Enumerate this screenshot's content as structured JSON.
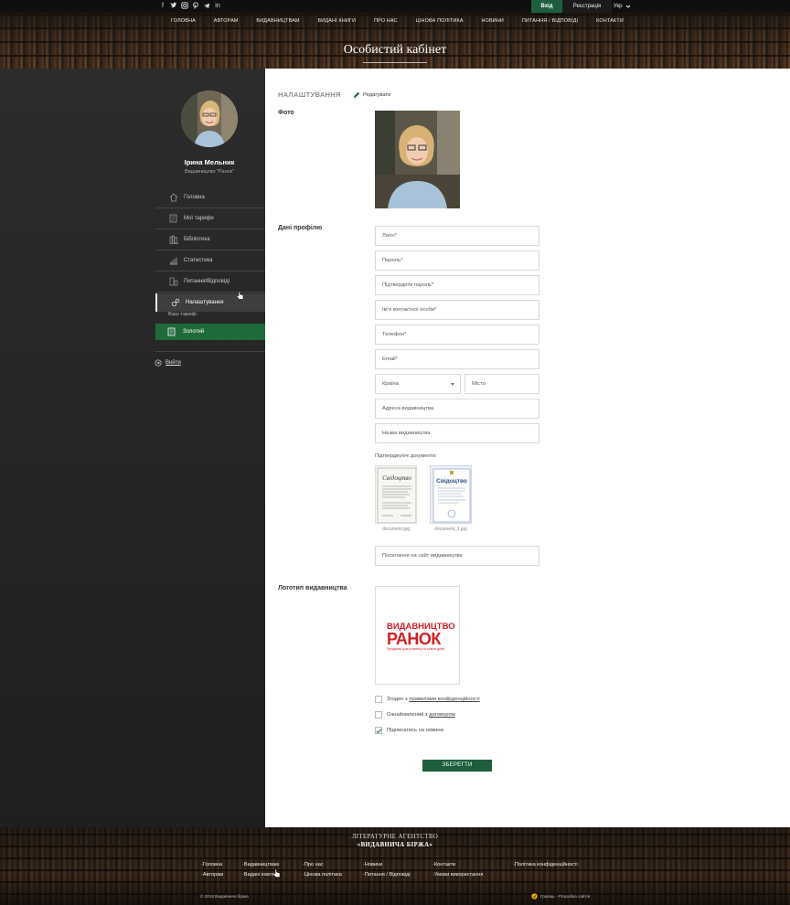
{
  "topbar": {
    "social": [
      "facebook-icon",
      "twitter-icon",
      "instagram-icon",
      "pinterest-icon",
      "telegram-icon",
      "linkedin-icon"
    ],
    "login": "Вхід",
    "register": "Реєстрація",
    "language": "Укр"
  },
  "nav": [
    "ГОЛОВНА",
    "АВТОРАМ",
    "ВИДАВНИЦТВАМ",
    "ВИДАНІ КНИГИ",
    "ПРО НАС",
    "ЦІНОВА ПОЛІТИКА",
    "НОВИНИ",
    "ПИТАННЯ / ВІДПОВІДІ",
    "КОНТАКТИ"
  ],
  "hero": {
    "title": "Особистий кабінет"
  },
  "sidebar": {
    "user_name": "Ірина Мельник",
    "user_company": "Видавництво \"Ранок\"",
    "menu": [
      {
        "label": "Головна",
        "icon": "home-icon"
      },
      {
        "label": "Мої тарифи",
        "icon": "tariffs-icon"
      },
      {
        "label": "Бібліотека",
        "icon": "library-icon"
      },
      {
        "label": "Статистика",
        "icon": "statistics-icon"
      },
      {
        "label": "Питання/Відповіді",
        "icon": "faq-icon"
      },
      {
        "label": "Налаштування",
        "icon": "settings-icon"
      }
    ],
    "tariff_label": "Ваш тариф:",
    "tariff_value": "Золотий",
    "logout": "Вийти"
  },
  "settings": {
    "title": "НАЛАШТУВАННЯ",
    "edit": "Редагувати",
    "photo_label": "Фото",
    "profile_label": "Дані профілю",
    "logo_label": "Логотип видавництва",
    "fields": {
      "login": "Логін",
      "password": "Пароль",
      "confirm_password": "Підтвердити пароль",
      "contact_name": "Ім'я контактної особи",
      "phone": "Телефон",
      "email": "Email",
      "country": "Країна",
      "city": "Місто",
      "address": "Адреса видавництва",
      "publisher_name": "Назва видавництва",
      "website": "Посилання на сайт видавництва"
    },
    "required_mark": "*",
    "docs_label": "Підтверджуючі документи:",
    "docs": [
      {
        "file": "document.jpg",
        "heading": "Свідоцтво"
      },
      {
        "file": "document_1.jpg",
        "heading": "Свідоцтво"
      }
    ],
    "logo": {
      "line1": "ВИДАВНИЦТВО",
      "line2": "РАНОК",
      "line3": "Продаємо для розвитку та освіти дітей"
    },
    "checks": [
      {
        "prefix": "Згоден з ",
        "link": "правилами конфіденційності",
        "checked": false
      },
      {
        "prefix": "Ознайомлений з ",
        "link": "договором",
        "checked": false
      },
      {
        "prefix": "Підписатись на новини",
        "link": "",
        "checked": true
      }
    ],
    "save": "ЗБЕРЕГТИ"
  },
  "footer": {
    "brand_line1": "ЛІТЕРАТУРНЕ АГЕНТСТВО",
    "brand_line2": "«ВИДАВНИЧА БІРЖА»",
    "links": [
      "Головна",
      "Видавництвам",
      "Про нас",
      "Новини",
      "Контакти",
      "Політика конфіденційності",
      "Авторам",
      "Видані книги",
      "Цінова політика",
      "Питання / Відповіді",
      "Умови використання"
    ],
    "copyright": "© 2018 Видавнича біржа",
    "developer": "Гравіць - Розробка сайтів"
  }
}
